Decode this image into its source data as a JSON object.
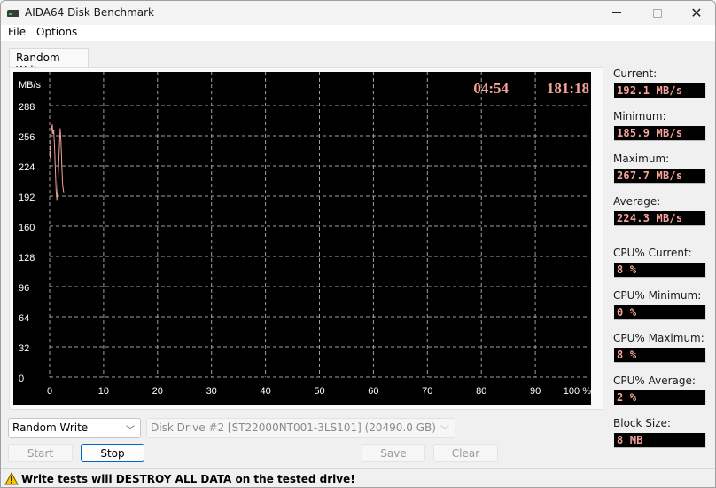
{
  "window": {
    "title": "AIDA64 Disk Benchmark",
    "icon": "disk-drive-icon",
    "controls": {
      "minimize": "minimize-icon",
      "maximize": "maximize-icon",
      "close": "close-icon"
    }
  },
  "menu": [
    "File",
    "Options"
  ],
  "tabs": [
    {
      "label": "Random Write",
      "active": true
    }
  ],
  "chart_data": {
    "type": "line",
    "title": "",
    "ylabel": "MB/s",
    "xlabel": "",
    "x_unit": "%",
    "xlim": [
      0,
      100
    ],
    "ylim": [
      0,
      288
    ],
    "y_ticks": [
      0,
      32,
      64,
      96,
      128,
      160,
      192,
      224,
      256,
      288
    ],
    "x_ticks": [
      0,
      10,
      20,
      30,
      40,
      50,
      60,
      70,
      80,
      90,
      100
    ],
    "x_tick_labels": [
      "0",
      "10",
      "20",
      "30",
      "40",
      "50",
      "60",
      "70",
      "80",
      "90",
      "100 %"
    ],
    "grid": true,
    "elapsed_time": "04:54",
    "remaining_time": "181:18",
    "colors": {
      "background": "#000000",
      "grid": "#a0a0a0",
      "line": "#f5a29a",
      "text": "#ffffff",
      "timer": "#f5a29a"
    },
    "series": [
      {
        "name": "Random Write",
        "points": [
          [
            0.0,
            240
          ],
          [
            0.1,
            232
          ],
          [
            0.2,
            250
          ],
          [
            0.35,
            262
          ],
          [
            0.5,
            268
          ],
          [
            0.6,
            258
          ],
          [
            0.75,
            262
          ],
          [
            0.9,
            245
          ],
          [
            1.05,
            222
          ],
          [
            1.2,
            198
          ],
          [
            1.35,
            188
          ],
          [
            1.5,
            200
          ],
          [
            1.65,
            222
          ],
          [
            1.8,
            244
          ],
          [
            1.95,
            264
          ],
          [
            2.1,
            250
          ],
          [
            2.25,
            226
          ],
          [
            2.4,
            205
          ],
          [
            2.55,
            198
          ],
          [
            2.65,
            196
          ]
        ]
      }
    ]
  },
  "stats": [
    {
      "label": "Current:",
      "value": "192.1 MB/s"
    },
    {
      "label": "Minimum:",
      "value": "185.9 MB/s"
    },
    {
      "label": "Maximum:",
      "value": "267.7 MB/s"
    },
    {
      "label": "Average:",
      "value": "224.3 MB/s"
    },
    {
      "label": "CPU% Current:",
      "value": "8 %"
    },
    {
      "label": "CPU% Minimum:",
      "value": "0 %"
    },
    {
      "label": "CPU% Maximum:",
      "value": "8 %"
    },
    {
      "label": "CPU% Average:",
      "value": "2 %"
    },
    {
      "label": "Block Size:",
      "value": "8 MB"
    }
  ],
  "controls": {
    "test_select": "Random Write",
    "drive_select": "Disk Drive #2  [ST22000NT001-3LS101]  (20490.0 GB)",
    "start": "Start",
    "stop": "Stop",
    "save": "Save",
    "clear": "Clear"
  },
  "status": {
    "icon": "warning-icon",
    "message": "Write tests will DESTROY ALL DATA on the tested drive!"
  }
}
